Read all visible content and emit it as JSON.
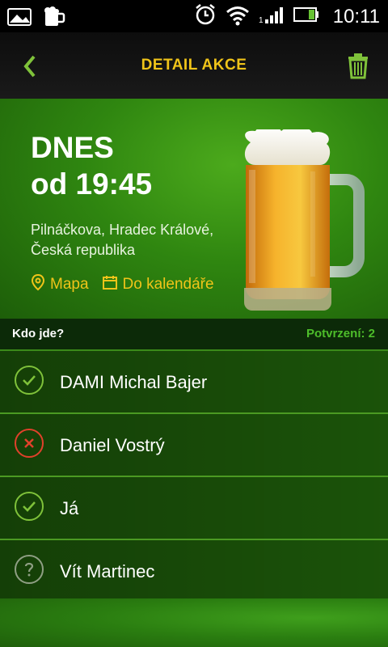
{
  "status_bar": {
    "time": "10:11",
    "icons": [
      "image-icon",
      "beer-mug-icon",
      "alarm-clock-icon",
      "wifi-icon",
      "signal-icon",
      "battery-icon"
    ]
  },
  "header": {
    "title": "DETAIL AKCE",
    "icons": [
      "back-chevron-icon",
      "trash-icon"
    ]
  },
  "event": {
    "day": "DNES",
    "time": "od 19:45",
    "address_line1": "Pilnáčkova, Hradec Králové,",
    "address_line2": "Česká republika",
    "map_label": "Mapa",
    "calendar_label": "Do kalendáře"
  },
  "section": {
    "title": "Kdo jde?",
    "confirmations": "Potvrzení: 2"
  },
  "attendees": [
    {
      "name": "DAMI Michal Bajer",
      "status": "confirmed"
    },
    {
      "name": "Daniel Vostrý",
      "status": "declined"
    },
    {
      "name": "Já",
      "status": "confirmed"
    },
    {
      "name": "Vít Martinec",
      "status": "unknown"
    }
  ],
  "colors": {
    "accent": "#f0c419",
    "confirmed": "#7fc23a",
    "declined": "#e0412b",
    "unknown": "#8f9f84"
  }
}
